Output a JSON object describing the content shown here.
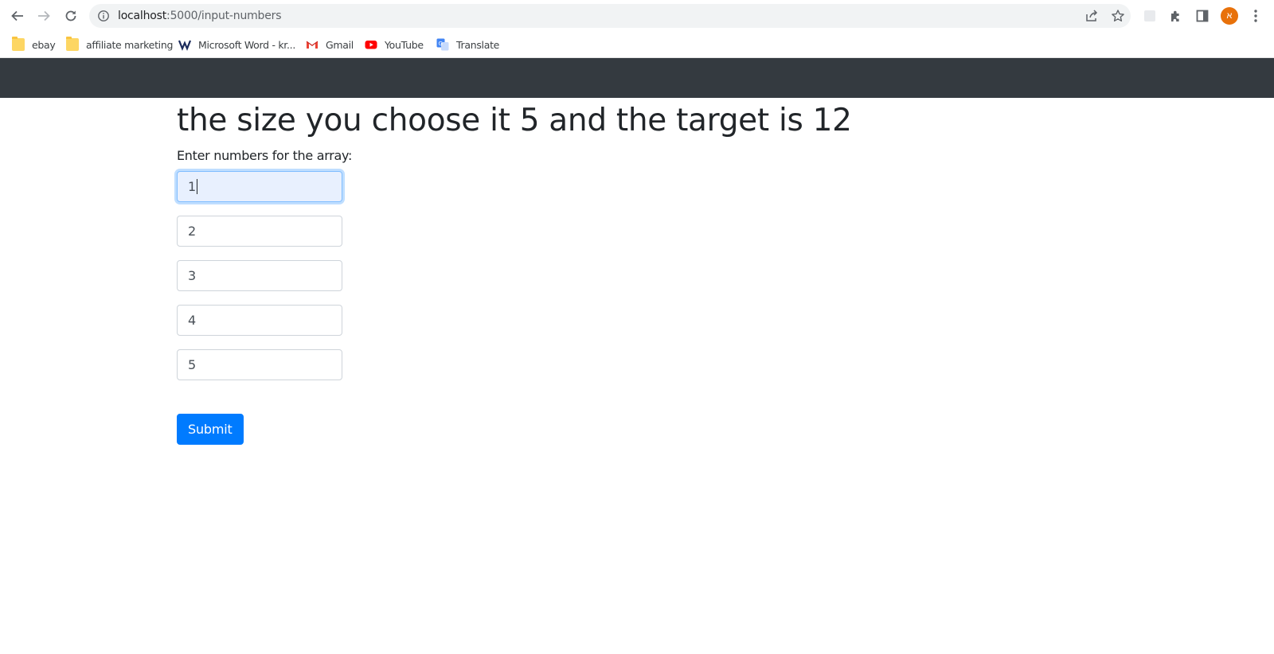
{
  "browser": {
    "url_host": "localhost",
    "url_path": ":5000/input-numbers",
    "profile_initial": "א",
    "bookmarks": [
      {
        "label": "ebay",
        "icon": "folder-icon"
      },
      {
        "label": "affiliate marketing",
        "icon": "folder-icon"
      },
      {
        "label": "Microsoft Word - kr...",
        "icon": "word-icon"
      },
      {
        "label": "Gmail",
        "icon": "gmail-icon"
      },
      {
        "label": "YouTube",
        "icon": "youtube-icon"
      },
      {
        "label": "Translate",
        "icon": "translate-icon"
      }
    ]
  },
  "page": {
    "heading": "the size you choose it 5 and the target is 12",
    "prompt": "Enter numbers for the array:",
    "inputs": [
      "1",
      "2",
      "3",
      "4",
      "5"
    ],
    "submit_label": "Submit"
  },
  "colors": {
    "navbar": "#343a40",
    "primary": "#007bff",
    "profile": "#e8710a"
  }
}
